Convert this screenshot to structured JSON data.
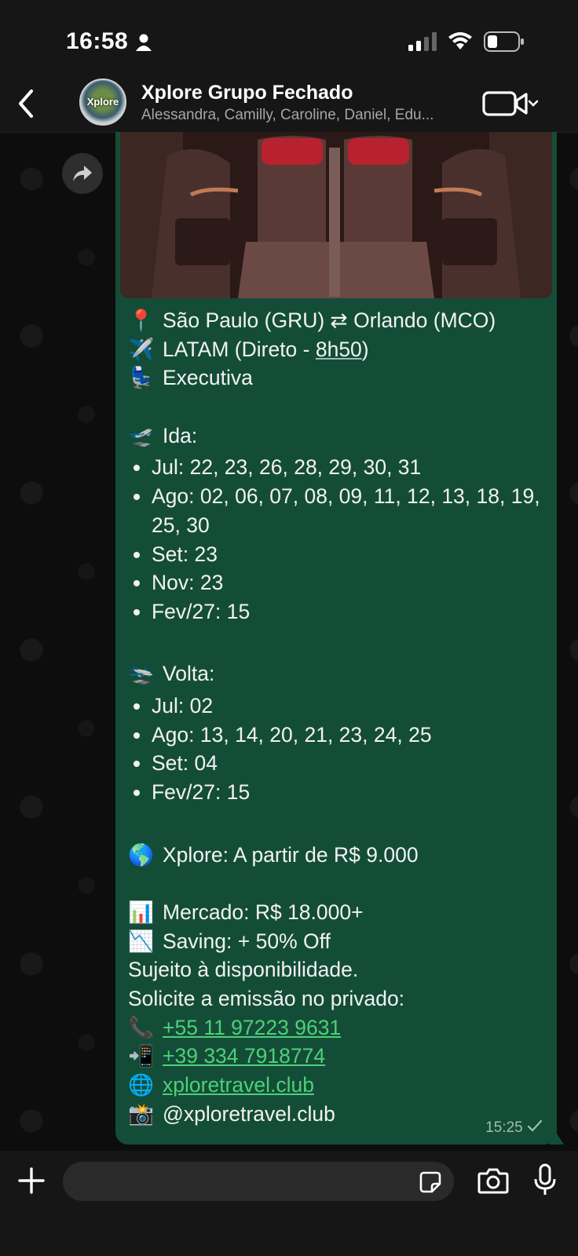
{
  "status_bar": {
    "time": "16:58"
  },
  "header": {
    "title": "Xplore Grupo Fechado",
    "subtitle": "Alessandra, Camilly, Caroline, Daniel, Edu...",
    "avatar_text": "Xplore"
  },
  "message": {
    "route": "São Paulo (GRU) ⇄ Orlando (MCO)",
    "airline_prefix": "LATAM (Direto - ",
    "duration": "8h50",
    "airline_suffix": ")",
    "cabin": "Executiva",
    "outbound_label": "Ida:",
    "outbound": [
      "Jul: 22, 23, 26, 28, 29, 30, 31",
      "Ago: 02, 06, 07, 08, 09, 11, 12, 13, 18, 19, 25, 30",
      "Set: 23",
      "Nov: 23",
      "Fev/27: 15"
    ],
    "return_label": "Volta:",
    "return": [
      "Jul: 02",
      "Ago: 13, 14, 20, 21, 23, 24, 25",
      "Set: 04",
      "Fev/27: 15"
    ],
    "xplore_price": "Xplore: A partir de R$ 9.000",
    "market_price": "Mercado: R$ 18.000+",
    "saving": "Saving: + 50% Off",
    "availability": "Sujeito à disponibilidade.",
    "request": "Solicite a emissão no privado:",
    "phone1": "+55 11 97223 9631",
    "phone2": "+39 334 7918774",
    "website": "xploretravel.club",
    "instagram": "@xploretravel.club",
    "time": "15:25"
  },
  "icons": {
    "pin": "📍",
    "plane": "✈️",
    "seat": "💺",
    "departure": "🛫",
    "arrival": "🛬",
    "globe": "🌎",
    "chart": "📊",
    "chart_down": "📉",
    "phone": "📞",
    "mobile": "📲",
    "web": "🌐",
    "camera": "📸"
  },
  "colors": {
    "bubble": "#144d37",
    "link": "#4dd07b",
    "background": "#0b0b0b"
  }
}
